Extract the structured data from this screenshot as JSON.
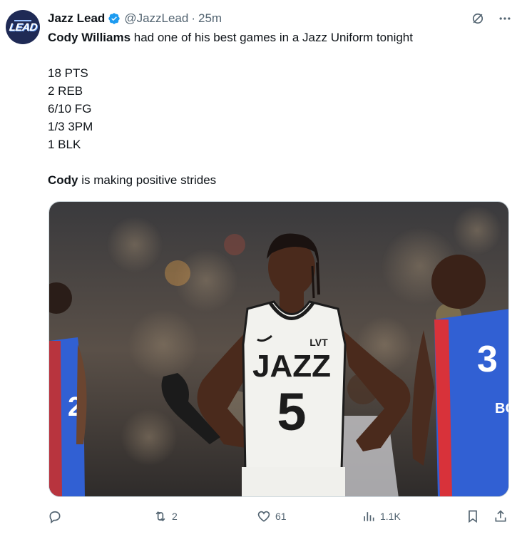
{
  "author": {
    "name": "Jazz Lead",
    "handle": "@JazzLead",
    "separator": "·",
    "time": "25m",
    "avatar_text": "LEAD"
  },
  "post": {
    "line1_bold": "Cody Williams",
    "line1_rest": " had one of his best games in a Jazz Uniform tonight",
    "stats": [
      "18 PTS",
      "2 REB",
      "6/10 FG",
      "1/3 3PM",
      "1 BLK"
    ],
    "line2_bold": "Cody",
    "line2_rest": " is making positive strides"
  },
  "image": {
    "jersey_team": "JAZZ",
    "jersey_number": "5",
    "sponsor": "LVT",
    "opponent_number_partial": "3",
    "opponent_name_partial": "BO",
    "left_player_partial": "2"
  },
  "actions": {
    "replies": "",
    "reposts": "2",
    "likes": "61",
    "views": "1.1K"
  },
  "colors": {
    "accent": "#1d9bf0",
    "muted": "#536471",
    "jazz_white": "#f2f2ee",
    "opponent_blue": "#2f5fd0",
    "opponent_red": "#d8323a"
  },
  "icons": [
    "verified-badge-icon",
    "grok-icon",
    "more-icon",
    "reply-icon",
    "repost-icon",
    "like-icon",
    "views-icon",
    "bookmark-icon",
    "share-icon"
  ]
}
